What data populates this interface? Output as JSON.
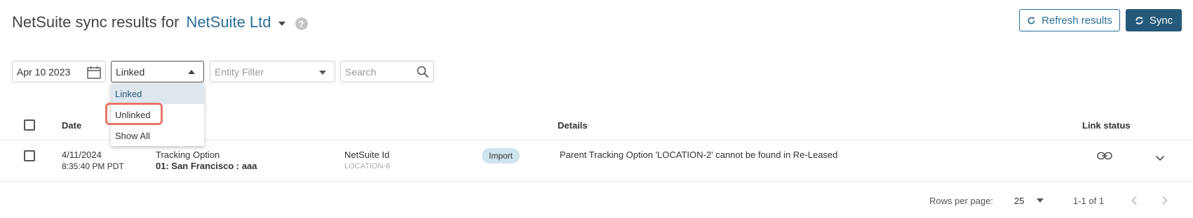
{
  "header": {
    "title_prefix": "NetSuite sync results for",
    "org_name": "NetSuite Ltd",
    "help_glyph": "?",
    "refresh_label": "Refresh results",
    "sync_label": "Sync"
  },
  "filters": {
    "date_value": "Apr 10 2023",
    "link_value": "Linked",
    "entity_placeholder": "Entity Filter",
    "search_placeholder": "Search"
  },
  "dropdown": {
    "options": [
      "Linked",
      "Unlinked",
      "Show All"
    ]
  },
  "table": {
    "columns": [
      "Date",
      "Details",
      "Link status"
    ],
    "rows": [
      {
        "date": "4/11/2024",
        "time": "8:35:40 PM PDT",
        "entity_type": "Tracking Option",
        "entity_name": "01: San Francisco : aaa",
        "id_label": "NetSuite Id",
        "id_value": "LOCATION-6",
        "direction": "Import",
        "details": "Parent Tracking Option 'LOCATION-2' cannot be found in Re-Leased"
      }
    ]
  },
  "pagination": {
    "rows_per_page_label": "Rows per page:",
    "rows_per_page": "25",
    "range": "1-1 of 1"
  },
  "colors": {
    "accent": "#2a6f97",
    "primary_button": "#24597a",
    "selected_option_bg": "#dfe7ee",
    "highlight_outline": "#e8766a",
    "badge_bg": "#cfe5ee"
  },
  "icons": [
    "help-icon",
    "refresh-icon",
    "sync-icon",
    "calendar-icon",
    "search-icon",
    "link-icon",
    "expand-chevron-icon",
    "prev-page-icon",
    "next-page-icon"
  ]
}
